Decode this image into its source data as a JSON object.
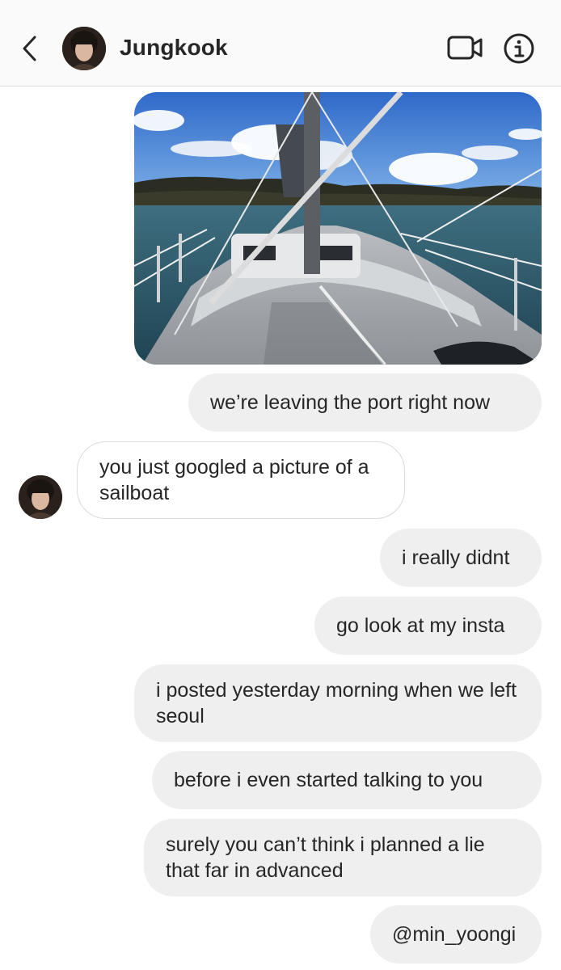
{
  "header": {
    "contact_name": "Jungkook",
    "back_icon": "chevron-left-icon",
    "video_icon": "video-camera-icon",
    "info_icon": "info-icon"
  },
  "photo": {
    "subject": "sailboat deck at sea"
  },
  "messages": [
    {
      "from": "me",
      "text": "we’re leaving the port right now"
    },
    {
      "from": "them",
      "text": "you just googled a picture of a sailboat"
    },
    {
      "from": "me",
      "text": "i really didnt"
    },
    {
      "from": "me",
      "text": "go look at my insta"
    },
    {
      "from": "me",
      "text": "i posted yesterday morning when we left seoul"
    },
    {
      "from": "me",
      "text": "before i even started talking to you"
    },
    {
      "from": "me",
      "text": "surely you can’t think i planned a lie that far in advanced"
    },
    {
      "from": "me",
      "text": "@min_yoongi"
    }
  ],
  "colors": {
    "header_bg": "#fafafa",
    "my_bubble": "#efefef",
    "their_bubble_border": "#dbdbdb",
    "text": "#262626"
  }
}
